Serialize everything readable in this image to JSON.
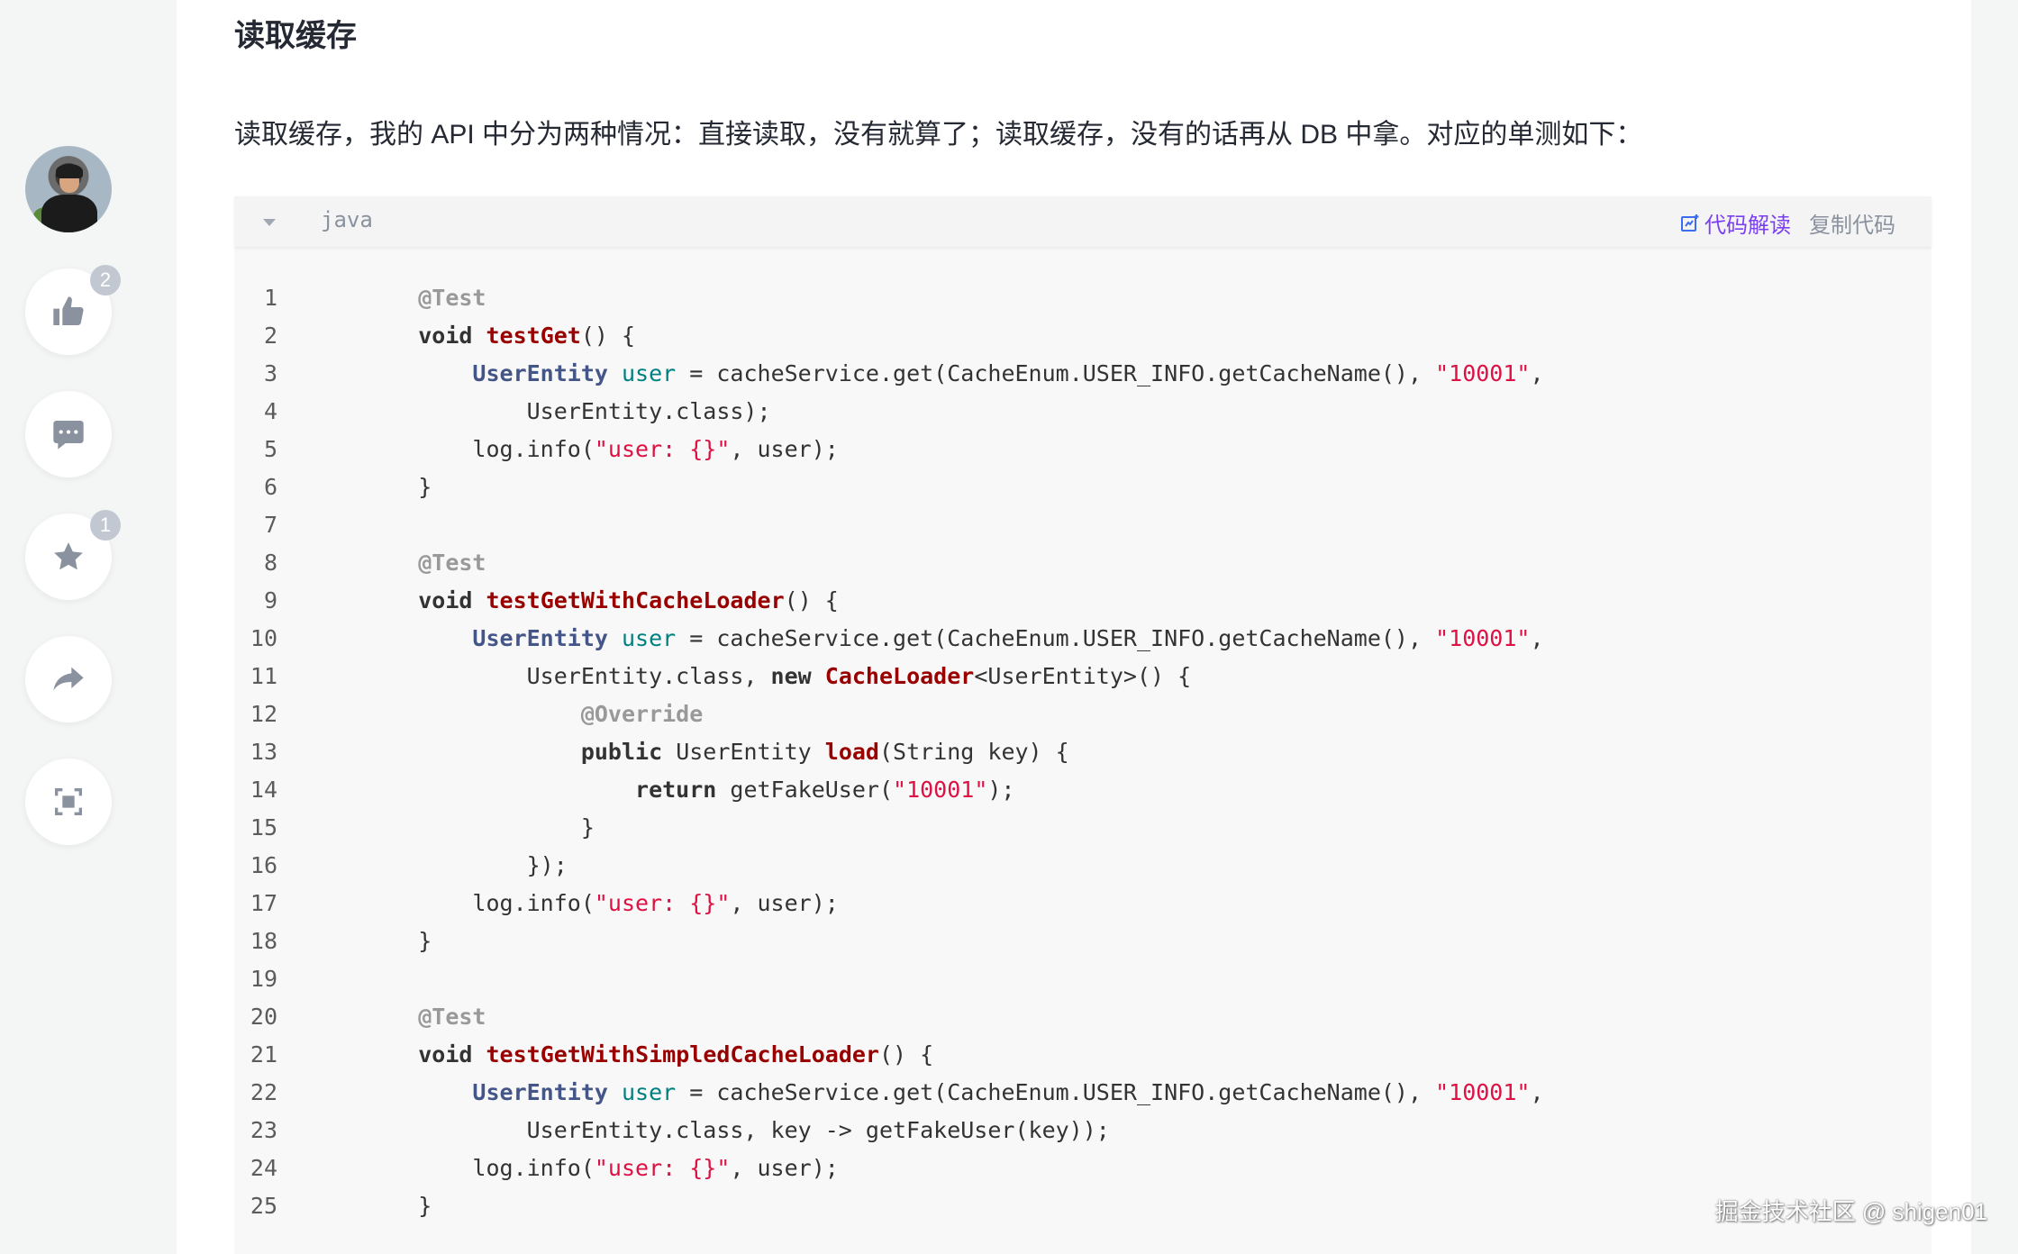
{
  "colors": {
    "accent_purple": "#7b3ff2",
    "icon_gray": "#8a919f",
    "string_red": "#dd1144",
    "function_red": "#990000",
    "type_blue": "#445588",
    "variable_teal": "#008080"
  },
  "rail": {
    "avatar_alt": "author-avatar",
    "like": {
      "icon": "thumbs-up-icon",
      "count": "2"
    },
    "comment": {
      "icon": "comment-icon"
    },
    "collect": {
      "icon": "star-icon",
      "count": "1"
    },
    "share": {
      "icon": "share-icon"
    },
    "fullscreen": {
      "icon": "fullscreen-icon"
    }
  },
  "article": {
    "heading": "读取缓存",
    "paragraph": "读取缓存，我的 API 中分为两种情况：直接读取，没有就算了；读取缓存，没有的话再从 DB 中拿。对应的单测如下："
  },
  "code_block": {
    "language": "java",
    "explain_label": "代码解读",
    "copy_label": "复制代码",
    "lines": [
      {
        "n": "1",
        "tokens": [
          {
            "t": "    ",
            "c": "plain"
          },
          {
            "t": "@Test",
            "c": "ann"
          }
        ]
      },
      {
        "n": "2",
        "tokens": [
          {
            "t": "    ",
            "c": "plain"
          },
          {
            "t": "void",
            "c": "kw"
          },
          {
            "t": " ",
            "c": "plain"
          },
          {
            "t": "testGet",
            "c": "fn"
          },
          {
            "t": "() {",
            "c": "plain"
          }
        ]
      },
      {
        "n": "3",
        "tokens": [
          {
            "t": "        ",
            "c": "plain"
          },
          {
            "t": "UserEntity",
            "c": "type"
          },
          {
            "t": " ",
            "c": "plain"
          },
          {
            "t": "user",
            "c": "var"
          },
          {
            "t": " = cacheService.get(CacheEnum.USER_INFO.getCacheName(), ",
            "c": "plain"
          },
          {
            "t": "\"10001\"",
            "c": "str"
          },
          {
            "t": ",",
            "c": "plain"
          }
        ]
      },
      {
        "n": "4",
        "tokens": [
          {
            "t": "            UserEntity.class);",
            "c": "plain"
          }
        ]
      },
      {
        "n": "5",
        "tokens": [
          {
            "t": "        log.info(",
            "c": "plain"
          },
          {
            "t": "\"user: {}\"",
            "c": "str"
          },
          {
            "t": ", user);",
            "c": "plain"
          }
        ]
      },
      {
        "n": "6",
        "tokens": [
          {
            "t": "    }",
            "c": "plain"
          }
        ]
      },
      {
        "n": "7",
        "tokens": []
      },
      {
        "n": "8",
        "tokens": [
          {
            "t": "    ",
            "c": "plain"
          },
          {
            "t": "@Test",
            "c": "ann"
          }
        ]
      },
      {
        "n": "9",
        "tokens": [
          {
            "t": "    ",
            "c": "plain"
          },
          {
            "t": "void",
            "c": "kw"
          },
          {
            "t": " ",
            "c": "plain"
          },
          {
            "t": "testGetWithCacheLoader",
            "c": "fn"
          },
          {
            "t": "() {",
            "c": "plain"
          }
        ]
      },
      {
        "n": "10",
        "tokens": [
          {
            "t": "        ",
            "c": "plain"
          },
          {
            "t": "UserEntity",
            "c": "type"
          },
          {
            "t": " ",
            "c": "plain"
          },
          {
            "t": "user",
            "c": "var"
          },
          {
            "t": " = cacheService.get(CacheEnum.USER_INFO.getCacheName(), ",
            "c": "plain"
          },
          {
            "t": "\"10001\"",
            "c": "str"
          },
          {
            "t": ",",
            "c": "plain"
          }
        ]
      },
      {
        "n": "11",
        "tokens": [
          {
            "t": "            UserEntity.class, ",
            "c": "plain"
          },
          {
            "t": "new",
            "c": "kw"
          },
          {
            "t": " ",
            "c": "plain"
          },
          {
            "t": "CacheLoader",
            "c": "fn"
          },
          {
            "t": "<UserEntity>() {",
            "c": "plain"
          }
        ]
      },
      {
        "n": "12",
        "tokens": [
          {
            "t": "                ",
            "c": "plain"
          },
          {
            "t": "@Override",
            "c": "ann"
          }
        ]
      },
      {
        "n": "13",
        "tokens": [
          {
            "t": "                ",
            "c": "plain"
          },
          {
            "t": "public",
            "c": "kw"
          },
          {
            "t": " UserEntity ",
            "c": "plain"
          },
          {
            "t": "load",
            "c": "fn"
          },
          {
            "t": "(String key) {",
            "c": "plain"
          }
        ]
      },
      {
        "n": "14",
        "tokens": [
          {
            "t": "                    ",
            "c": "plain"
          },
          {
            "t": "return",
            "c": "kw"
          },
          {
            "t": " getFakeUser(",
            "c": "plain"
          },
          {
            "t": "\"10001\"",
            "c": "str"
          },
          {
            "t": ");",
            "c": "plain"
          }
        ]
      },
      {
        "n": "15",
        "tokens": [
          {
            "t": "                }",
            "c": "plain"
          }
        ]
      },
      {
        "n": "16",
        "tokens": [
          {
            "t": "            });",
            "c": "plain"
          }
        ]
      },
      {
        "n": "17",
        "tokens": [
          {
            "t": "        log.info(",
            "c": "plain"
          },
          {
            "t": "\"user: {}\"",
            "c": "str"
          },
          {
            "t": ", user);",
            "c": "plain"
          }
        ]
      },
      {
        "n": "18",
        "tokens": [
          {
            "t": "    }",
            "c": "plain"
          }
        ]
      },
      {
        "n": "19",
        "tokens": []
      },
      {
        "n": "20",
        "tokens": [
          {
            "t": "    ",
            "c": "plain"
          },
          {
            "t": "@Test",
            "c": "ann"
          }
        ]
      },
      {
        "n": "21",
        "tokens": [
          {
            "t": "    ",
            "c": "plain"
          },
          {
            "t": "void",
            "c": "kw"
          },
          {
            "t": " ",
            "c": "plain"
          },
          {
            "t": "testGetWithSimpledCacheLoader",
            "c": "fn"
          },
          {
            "t": "() {",
            "c": "plain"
          }
        ]
      },
      {
        "n": "22",
        "tokens": [
          {
            "t": "        ",
            "c": "plain"
          },
          {
            "t": "UserEntity",
            "c": "type"
          },
          {
            "t": " ",
            "c": "plain"
          },
          {
            "t": "user",
            "c": "var"
          },
          {
            "t": " = cacheService.get(CacheEnum.USER_INFO.getCacheName(), ",
            "c": "plain"
          },
          {
            "t": "\"10001\"",
            "c": "str"
          },
          {
            "t": ",",
            "c": "plain"
          }
        ]
      },
      {
        "n": "23",
        "tokens": [
          {
            "t": "            UserEntity.class, key -> getFakeUser(key));",
            "c": "plain"
          }
        ]
      },
      {
        "n": "24",
        "tokens": [
          {
            "t": "        log.info(",
            "c": "plain"
          },
          {
            "t": "\"user: {}\"",
            "c": "str"
          },
          {
            "t": ", user);",
            "c": "plain"
          }
        ]
      },
      {
        "n": "25",
        "tokens": [
          {
            "t": "    }",
            "c": "plain"
          }
        ]
      }
    ]
  },
  "watermark": "掘金技术社区 @ shigen01"
}
